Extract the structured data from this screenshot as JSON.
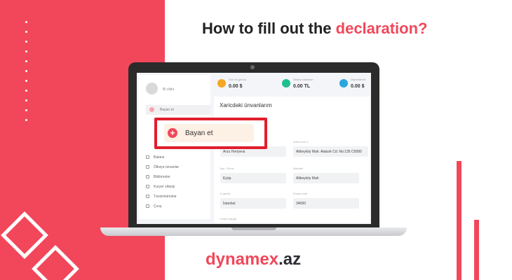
{
  "headline": {
    "part1": "How to fill out the ",
    "accent": "declaration?"
  },
  "brand": {
    "name": "dynamex",
    "tld": ".az"
  },
  "colors": {
    "accent": "#f2475a",
    "highlight_border": "#e11e2c",
    "dark": "#2c2c34"
  },
  "app": {
    "user": {
      "name": "Bi cildə"
    },
    "sidebar": {
      "add_declaration": "Bayan et",
      "items": [
        {
          "label": "Balans",
          "icon": "wallet-icon"
        },
        {
          "label": "Ölkəyə ünvanlar",
          "icon": "location-icon"
        },
        {
          "label": "Bildirmələr",
          "icon": "bell-icon"
        },
        {
          "label": "Kuryer sifarişi",
          "icon": "courier-icon"
        },
        {
          "label": "Tənzimləmələr",
          "icon": "gear-icon"
        },
        {
          "label": "Çıxış",
          "icon": "logout-icon"
        }
      ]
    },
    "stats": [
      {
        "label": "Son 30 gündə",
        "value": "0.00 $",
        "color": "#f5a623",
        "icon": "box-icon"
      },
      {
        "label": "Sifariş balansım",
        "value": "0.00 TL",
        "color": "#1fbf8f",
        "icon": "lira-icon"
      },
      {
        "label": "Depertamnt",
        "value": "0.00 $",
        "color": "#2aa6de",
        "icon": "card-icon"
      }
    ],
    "section_title": "Xaricdəki ünvanlarım",
    "fields": [
      {
        "label": "",
        "value": "Arzu Həriyeva"
      },
      {
        "label": "Adres sıtır 1",
        "value": "Alibeyköy Mah. Ataturk Cd. No:135 C9580"
      },
      {
        "label": "İlçe / Semt",
        "value": "Eyüp"
      },
      {
        "label": "Mahalle",
        "value": "Alibeyköy Mah"
      },
      {
        "label": "İl (şehir)",
        "value": "İstanbul"
      },
      {
        "label": "Posta code",
        "value": "34060"
      }
    ],
    "footer_label": "Kəfes başlığı"
  },
  "zoom": {
    "button_label": "Bayan et",
    "plus_symbol": "+"
  }
}
